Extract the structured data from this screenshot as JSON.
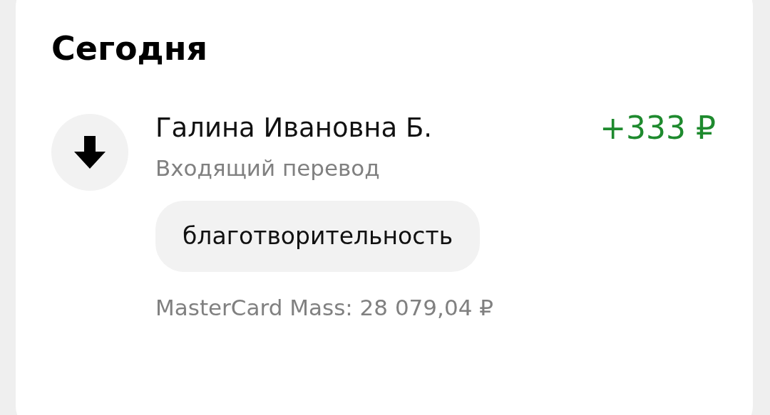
{
  "section_title": "Сегодня",
  "transaction": {
    "name": "Галина Ивановна Б.",
    "amount": "+333 ₽",
    "incoming": true,
    "type": "Входящий перевод",
    "tag": "благотворительность",
    "account": "MasterCard Mass: 28 079,04 ₽"
  }
}
